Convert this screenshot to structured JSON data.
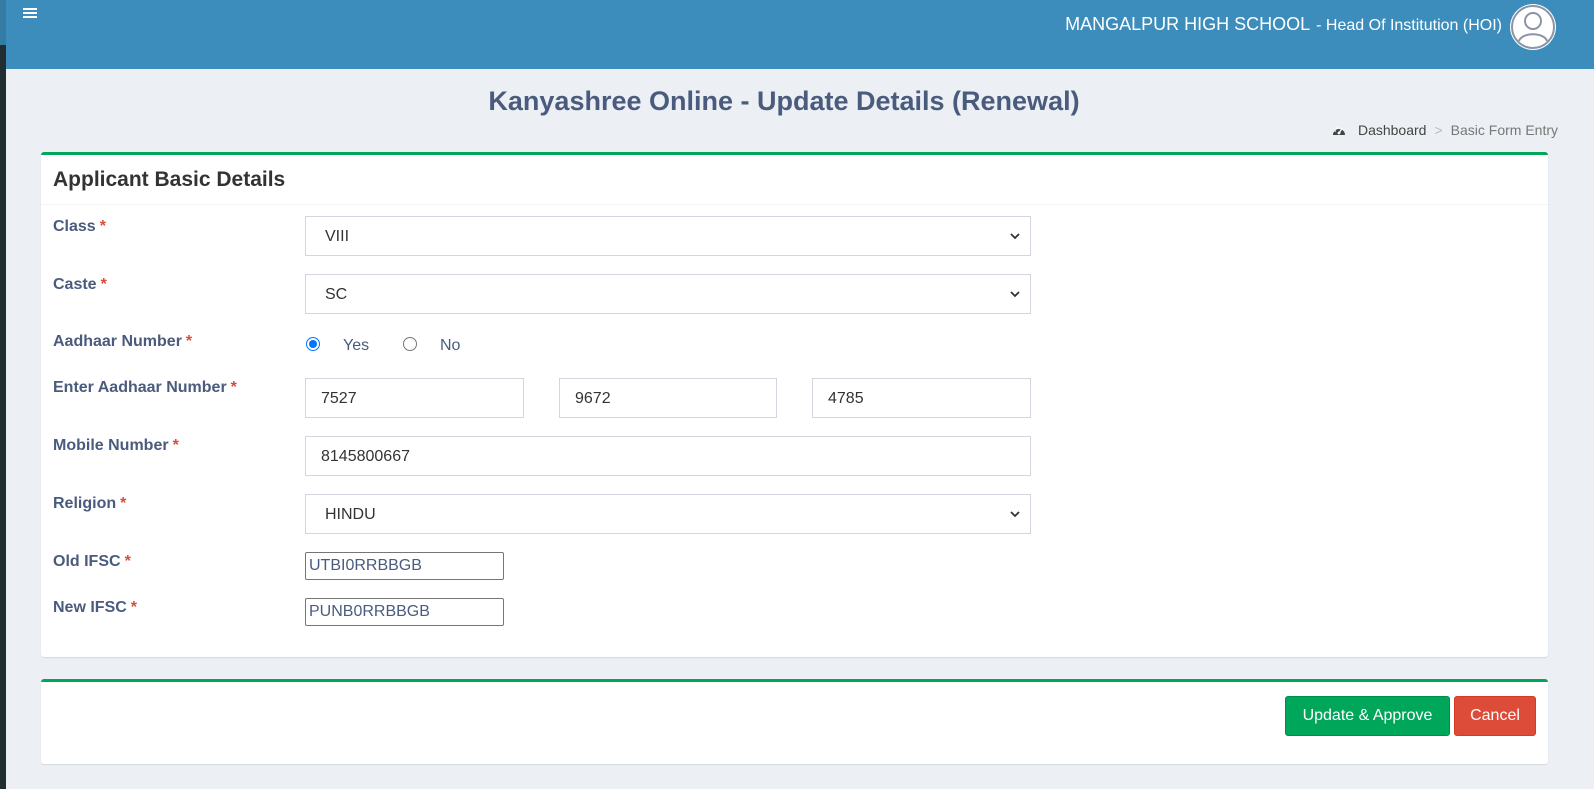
{
  "header": {
    "school_name": "MANGALPUR HIGH SCHOOL",
    "role": "- Head Of Institution (HOI)"
  },
  "page": {
    "title": "Kanyashree Online - Update Details (Renewal)",
    "breadcrumb": [
      "Dashboard",
      "Basic Form Entry"
    ]
  },
  "form": {
    "section_title": "Applicant Basic Details",
    "required_mark": "*",
    "class": {
      "label": "Class",
      "value": "VIII"
    },
    "caste": {
      "label": "Caste",
      "value": "SC"
    },
    "aadhaar": {
      "label": "Aadhaar Number",
      "options": [
        "Yes",
        "No"
      ],
      "selected": "Yes"
    },
    "aadhaar_number": {
      "label": "Enter Aadhaar Number",
      "parts": [
        "7527",
        "9672",
        "4785"
      ]
    },
    "mobile": {
      "label": "Mobile Number",
      "value": "8145800667"
    },
    "religion": {
      "label": "Religion",
      "value": "HINDU"
    },
    "old_ifsc": {
      "label": "Old IFSC",
      "value": "UTBI0RRBBGB"
    },
    "new_ifsc": {
      "label": "New IFSC",
      "value": "PUNB0RRBBGB"
    }
  },
  "actions": {
    "approve_label": "Update & Approve",
    "cancel_label": "Cancel"
  },
  "colors": {
    "header": "#3c8dbc",
    "accent_border": "#00a65a",
    "approve_button": "#00a65a",
    "cancel_button": "#dd4b39",
    "required": "#dd4b39"
  },
  "icons": {
    "menu": "hamburger-icon",
    "avatar": "user-avatar-icon",
    "dashboard": "tachometer-icon",
    "select": "chevron-down-icon"
  }
}
